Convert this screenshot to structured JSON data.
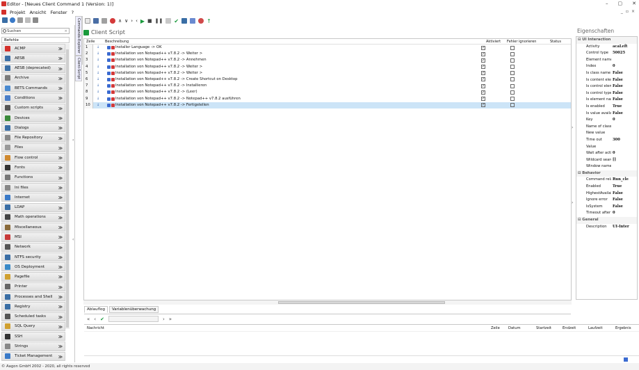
{
  "window": {
    "title": "Editor - [Neues Client Command 1 (Version: 1)]",
    "min": "–",
    "max": "▢",
    "close": "✕"
  },
  "menu": {
    "items": [
      "Projekt",
      "Ansicht",
      "Fenster",
      "?"
    ],
    "mdi_min": "_",
    "mdi_restore": "▫",
    "mdi_close": "×"
  },
  "left": {
    "search_placeholder": "Suchen",
    "header": "Befehle",
    "commands": [
      {
        "label": "ACMP",
        "color": "#d4302b"
      },
      {
        "label": "AESB",
        "color": "#3a6ea5"
      },
      {
        "label": "AESB (deprecated)",
        "color": "#3a6ea5"
      },
      {
        "label": "Archive",
        "color": "#7a7a7a"
      },
      {
        "label": "BETS Commands",
        "color": "#4a8ad0"
      },
      {
        "label": "Conditions",
        "color": "#4a7ec8"
      },
      {
        "label": "Custom scripts",
        "color": "#555555"
      },
      {
        "label": "Devices",
        "color": "#3a8a3a"
      },
      {
        "label": "Dialogs",
        "color": "#3a6ea5"
      },
      {
        "label": "File Repository",
        "color": "#888888"
      },
      {
        "label": "Files",
        "color": "#999999"
      },
      {
        "label": "Flow control",
        "color": "#d08a30"
      },
      {
        "label": "Fonts",
        "color": "#333333"
      },
      {
        "label": "Functions",
        "color": "#777777"
      },
      {
        "label": "Ini files",
        "color": "#888888"
      },
      {
        "label": "Internet",
        "color": "#3a7ac8"
      },
      {
        "label": "LDAP",
        "color": "#3a6ea5"
      },
      {
        "label": "Math operations",
        "color": "#444444"
      },
      {
        "label": "Miscellaneous",
        "color": "#8a6a3a"
      },
      {
        "label": "MSI",
        "color": "#c83a3a"
      },
      {
        "label": "Network",
        "color": "#555555"
      },
      {
        "label": "NTFS security",
        "color": "#3a6ea5"
      },
      {
        "label": "OS Deployment",
        "color": "#3a8ac8"
      },
      {
        "label": "Pagefile",
        "color": "#d0a030"
      },
      {
        "label": "Printer",
        "color": "#666666"
      },
      {
        "label": "Processes and Shell",
        "color": "#3a6ea5"
      },
      {
        "label": "Registry",
        "color": "#3a6ea5"
      },
      {
        "label": "Scheduled tasks",
        "color": "#555555"
      },
      {
        "label": "SQL Query",
        "color": "#d0a030"
      },
      {
        "label": "SSH",
        "color": "#333333"
      },
      {
        "label": "Strings",
        "color": "#888888"
      },
      {
        "label": "Ticket Management",
        "color": "#3a7ac8"
      }
    ]
  },
  "vtabs": [
    "Commands-Explorer",
    "Client-Script"
  ],
  "main": {
    "doc_title": "Client Script",
    "columns": {
      "line": "Zeile",
      "desc": "Beschreibung",
      "active": "Aktiviert",
      "ignore": "Fehler ignorieren",
      "status": "Status"
    },
    "rows": [
      {
        "n": "1",
        "desc": "Installer Language -> OK"
      },
      {
        "n": "2",
        "desc": "Installation von Notepad++ v7.8.2 -> Weiter >"
      },
      {
        "n": "3",
        "desc": "Installation von Notepad++ v7.8.2 -> Annehmen"
      },
      {
        "n": "4",
        "desc": "Installation von Notepad++ v7.8.2 -> Weiter >"
      },
      {
        "n": "5",
        "desc": "Installation von Notepad++ v7.8.2 -> Weiter >"
      },
      {
        "n": "6",
        "desc": "Installation von Notepad++ v7.8.2 -> Create Shortcut on Desktop"
      },
      {
        "n": "7",
        "desc": "Installation von Notepad++ v7.8.2 -> Installieren"
      },
      {
        "n": "8",
        "desc": "Installation von Notepad++ v7.8.2 -> (Leer)"
      },
      {
        "n": "9",
        "desc": "Installation von Notepad++ v7.8.2 -> Notepad++ v7.8.2 ausführen"
      },
      {
        "n": "10",
        "desc": "Installation von Notepad++ v7.8.2 -> Fertigstellen"
      }
    ],
    "check": "✓"
  },
  "bottom": {
    "tabs": [
      "Ablauflog",
      "Variablenüberwachung"
    ],
    "nav": {
      "first": "«",
      "prev": "‹",
      "ok": "✔",
      "next": "›",
      "last": "»"
    },
    "columns": [
      "Nachricht",
      "Zeile",
      "Datum",
      "Startzeit",
      "Endzeit",
      "Laufzeit",
      "Ergebnis"
    ]
  },
  "props": {
    "title": "Eigenschaften",
    "cat1": "UI Interaction",
    "rows1": [
      [
        "Activity",
        "acaLeft"
      ],
      [
        "Control type",
        "50025"
      ],
      [
        "Element name",
        ""
      ],
      [
        "Index",
        "0"
      ],
      [
        "Is class name availal",
        "False"
      ],
      [
        "Is content element",
        "False"
      ],
      [
        "Is control element",
        "False"
      ],
      [
        "Is control type availa",
        "False"
      ],
      [
        "Is element name ava",
        "False"
      ],
      [
        "Is enabled",
        "True"
      ],
      [
        "Is value available",
        "False"
      ],
      [
        "Key",
        "0"
      ],
      [
        "Name of class",
        ""
      ],
      [
        "New value",
        ""
      ],
      [
        "Time out",
        "300"
      ],
      [
        "Value",
        ""
      ],
      [
        "Wait after action",
        "0"
      ],
      [
        "Wildcard search",
        "[]"
      ],
      [
        "Window name",
        ""
      ]
    ],
    "cat2": "Behavior",
    "rows2": [
      [
        "Command relation",
        "Run_cle"
      ],
      [
        "Enabled",
        "True"
      ],
      [
        "HighestAvailableRigh",
        "False"
      ],
      [
        "Ignore error",
        "False"
      ],
      [
        "IsSystem",
        "False"
      ],
      [
        "Timeout after",
        "0"
      ]
    ],
    "cat3": "General",
    "rows3": [
      [
        "Description",
        "UI-Inter"
      ]
    ]
  },
  "footer": "© Aagon GmbH 2002 - 2020, all rights reserved"
}
